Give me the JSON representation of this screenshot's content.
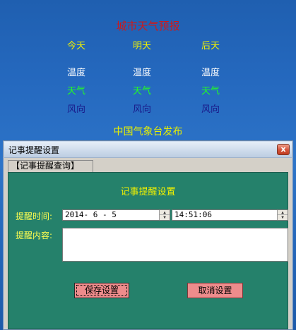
{
  "weather": {
    "title": "城市天气预报",
    "columns": [
      {
        "day": "今天",
        "temp": "温度",
        "weather": "天气",
        "wind": "风向"
      },
      {
        "day": "明天",
        "temp": "温度",
        "weather": "天气",
        "wind": "风向"
      },
      {
        "day": "后天",
        "temp": "温度",
        "weather": "天气",
        "wind": "风向"
      }
    ],
    "source": "中国气象台发布"
  },
  "dialog": {
    "title": "记事提醒设置",
    "close_label": "x",
    "group_tab": "【记事提醒查询】",
    "panel_title": "记事提醒设置",
    "remind_time_label": "提醒时间:",
    "date_value": "2014- 6 - 5",
    "time_value": "14:51:06",
    "remind_content_label": "提醒内容:",
    "content_value": "",
    "save_label": "保存设置",
    "cancel_label": "取消设置"
  },
  "colors": {
    "panel_bg": "#25816b",
    "button_bg": "#ee8c8c",
    "title_red": "#d01818",
    "label_yellow": "#ffff50"
  }
}
